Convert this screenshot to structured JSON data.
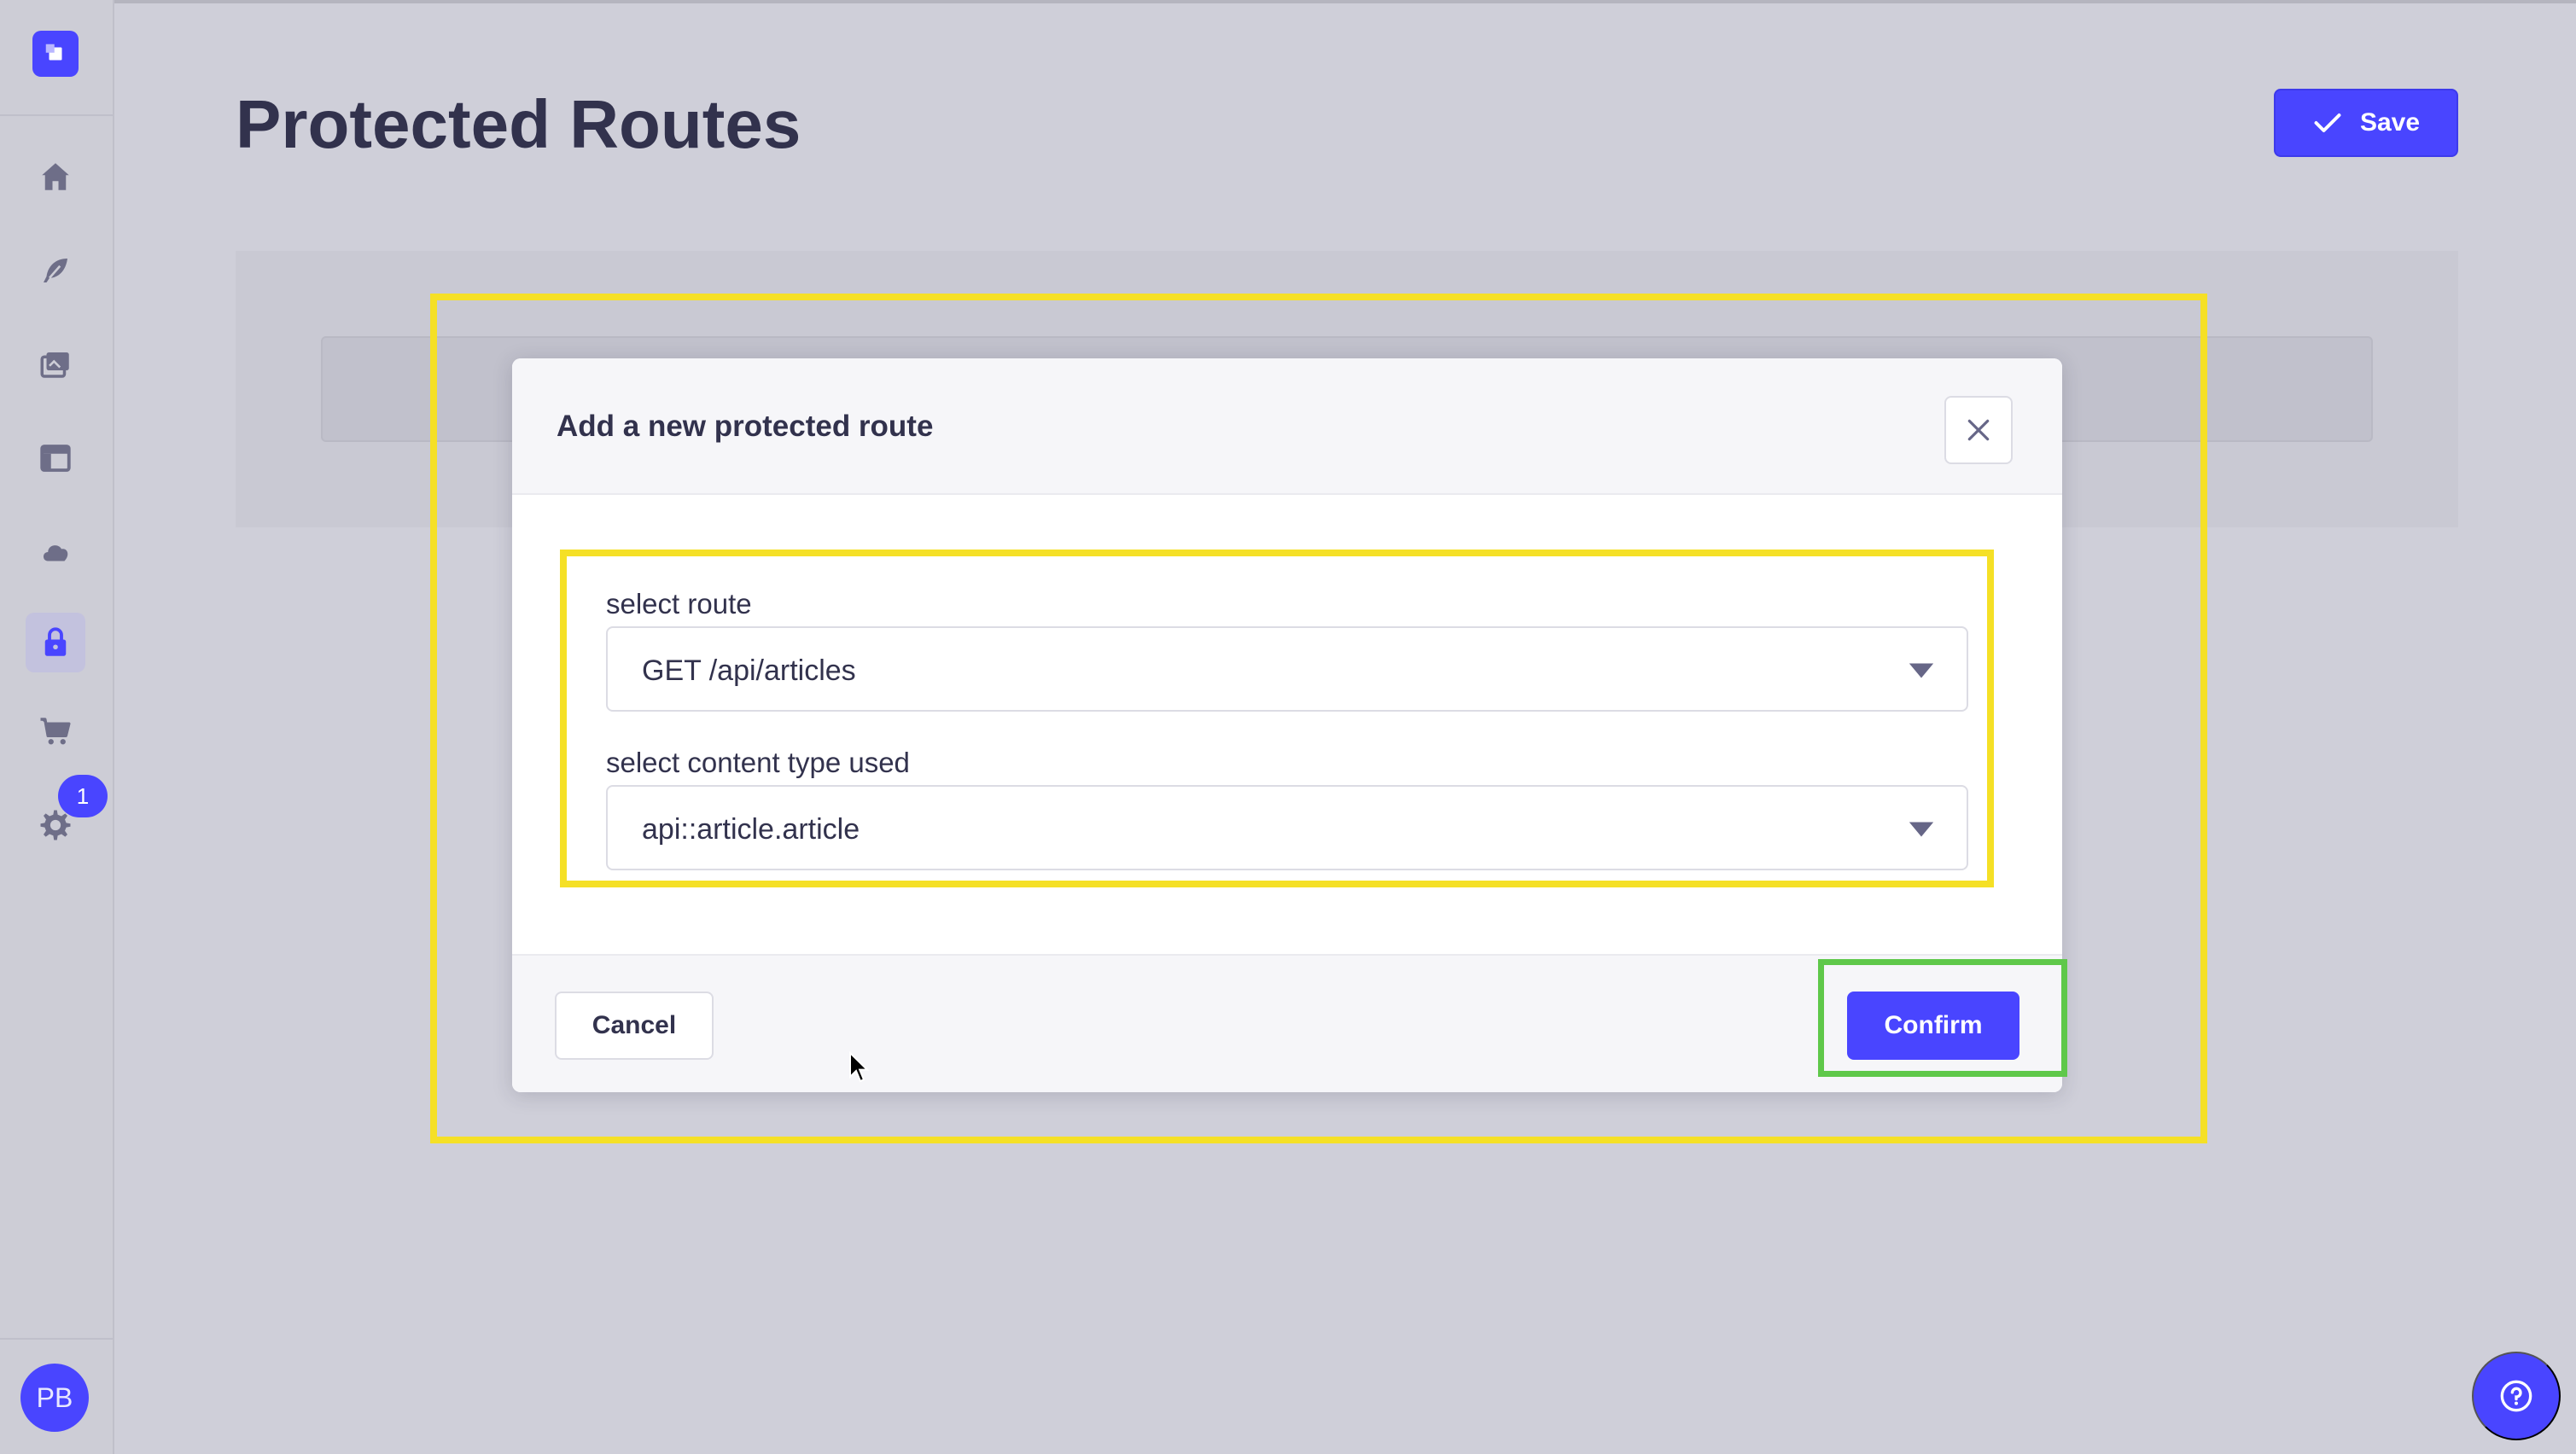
{
  "page": {
    "title": "Protected Routes",
    "save_label": "Save"
  },
  "sidebar": {
    "items": [
      {
        "icon": "home-icon"
      },
      {
        "icon": "feather-icon"
      },
      {
        "icon": "media-library-icon"
      },
      {
        "icon": "layout-icon"
      },
      {
        "icon": "cloud-icon"
      },
      {
        "icon": "lock-icon",
        "active": true
      },
      {
        "icon": "cart-icon"
      },
      {
        "icon": "gear-icon",
        "badge": "1"
      }
    ],
    "settings_badge": "1",
    "avatar_initials": "PB"
  },
  "modal": {
    "title": "Add a new protected route",
    "route_label": "select route",
    "route_value": "GET /api/articles",
    "content_type_label": "select content type used",
    "content_type_value": "api::article.article",
    "cancel_label": "Cancel",
    "confirm_label": "Confirm"
  },
  "colors": {
    "primary": "#4945ff",
    "highlight_yellow": "#f5e026",
    "highlight_green": "#5fc84a",
    "text_dark": "#32324d"
  }
}
